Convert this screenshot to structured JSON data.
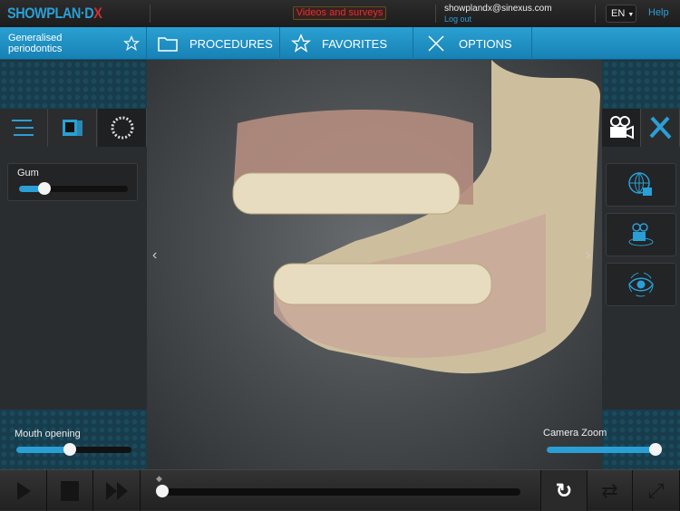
{
  "header": {
    "logo": "SHOWPLAN·DX",
    "videos_label": "Videos and surveys",
    "user_email": "showplandx@sinexus.com",
    "logout_label": "Log out",
    "language": "EN",
    "help_label": "Help"
  },
  "nav": {
    "breadcrumb": "Generalised periodontics",
    "items": [
      {
        "label": "PROCEDURES",
        "icon": "folder-icon"
      },
      {
        "label": "FAVORITES",
        "icon": "star-icon"
      },
      {
        "label": "OPTIONS",
        "icon": "tools-icon"
      }
    ]
  },
  "left_panel": {
    "tabs": [
      "sliders-icon",
      "xray-photos-icon",
      "dial-icon"
    ],
    "gum": {
      "label": "Gum",
      "value": 0.2
    },
    "mouth_opening": {
      "label": "Mouth opening",
      "value": 0.44
    }
  },
  "right_panel": {
    "tabs": [
      "camera-icon",
      "tools-icon"
    ],
    "buttons": [
      "globe-lock-icon",
      "camera-rotate-icon",
      "eye-rotate-icon"
    ],
    "camera_zoom": {
      "label": "Camera Zoom",
      "value": 1.0
    }
  },
  "playback": {
    "progress": 0.0
  },
  "colors": {
    "accent": "#2a9fd6",
    "brand_red": "#d03030"
  }
}
